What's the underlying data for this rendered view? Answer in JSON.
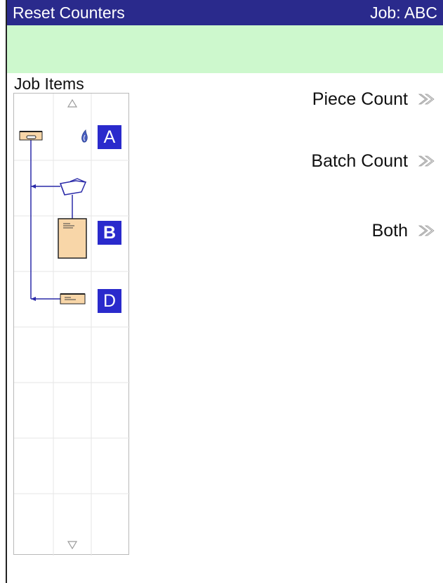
{
  "titlebar": {
    "title": "Reset Counters",
    "job": "Job:  ABC",
    "color": "#2a2a8c"
  },
  "banner": {
    "color": "#cdf8cd"
  },
  "panel": {
    "label": "Job Items",
    "items": [
      {
        "badge": "A",
        "icon": "envelope-slot-icon"
      },
      {
        "badge": "",
        "icon": "folder-insert-icon"
      },
      {
        "badge": "B",
        "icon": "document-sheet-icon"
      },
      {
        "badge": "D",
        "icon": "envelope-small-icon"
      }
    ]
  },
  "actions": [
    {
      "label": "Piece Count"
    },
    {
      "label": "Batch Count"
    },
    {
      "label": "Both"
    }
  ],
  "colors": {
    "badge": "#2a2acc",
    "line": "#2a2aa8",
    "item_fill": "#f8d6a8"
  }
}
